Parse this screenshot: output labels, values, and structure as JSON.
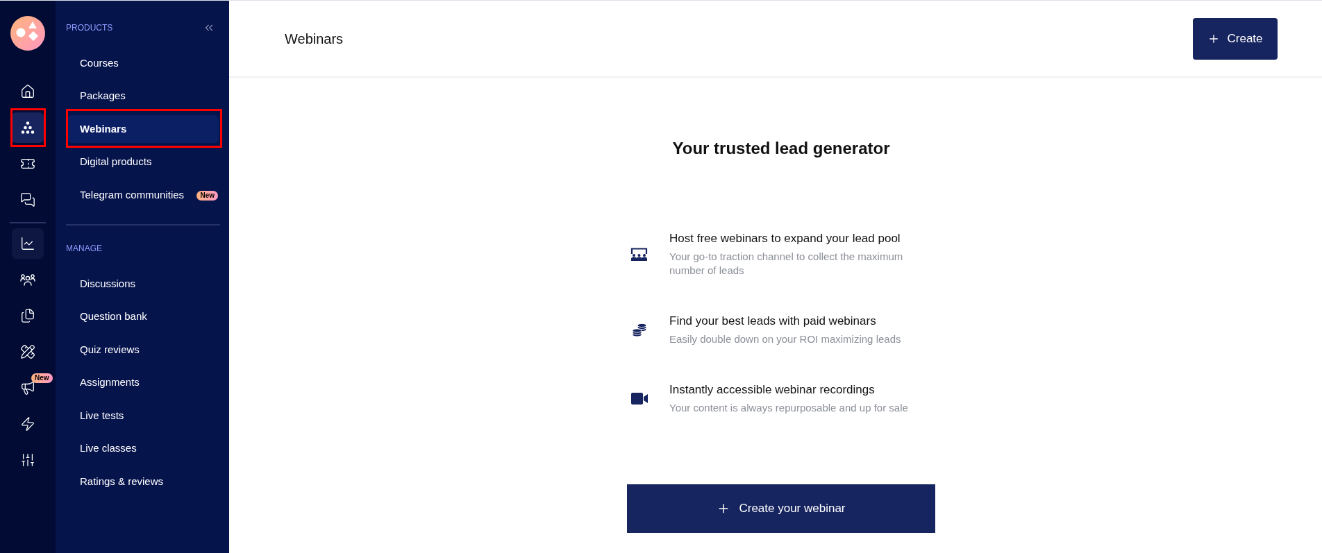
{
  "rail": {
    "sections": [
      {
        "items": [
          {
            "selected": false,
            "hovered": false,
            "outlined": false
          },
          {
            "selected": true,
            "hovered": false,
            "outlined": true
          },
          {
            "selected": false,
            "hovered": false,
            "outlined": false
          },
          {
            "selected": false,
            "hovered": false,
            "outlined": false
          }
        ]
      },
      {
        "items": [
          {
            "selected": false,
            "hovered": true,
            "outlined": false
          },
          {
            "selected": false,
            "hovered": false,
            "outlined": false
          },
          {
            "selected": false,
            "hovered": false,
            "outlined": false
          },
          {
            "selected": false,
            "hovered": false,
            "outlined": false
          },
          {
            "selected": false,
            "hovered": false,
            "outlined": false,
            "badge": "New"
          },
          {
            "selected": false,
            "hovered": false,
            "outlined": false
          },
          {
            "selected": false,
            "hovered": false,
            "outlined": false
          }
        ]
      }
    ]
  },
  "sidebar": {
    "sections": [
      {
        "heading": "PRODUCTS",
        "items": [
          {
            "label": "Courses",
            "selected": false,
            "outlined": false
          },
          {
            "label": "Packages",
            "selected": false,
            "outlined": false
          },
          {
            "label": "Webinars",
            "selected": true,
            "outlined": true
          },
          {
            "label": "Digital products",
            "selected": false,
            "outlined": false
          },
          {
            "label": "Telegram communities",
            "selected": false,
            "outlined": false,
            "badge": "New"
          }
        ]
      },
      {
        "heading": "MANAGE",
        "items": [
          {
            "label": "Discussions",
            "selected": false,
            "outlined": false
          },
          {
            "label": "Question bank",
            "selected": false,
            "outlined": false
          },
          {
            "label": "Quiz reviews",
            "selected": false,
            "outlined": false
          },
          {
            "label": "Assignments",
            "selected": false,
            "outlined": false
          },
          {
            "label": "Live tests",
            "selected": false,
            "outlined": false
          },
          {
            "label": "Live classes",
            "selected": false,
            "outlined": false
          },
          {
            "label": "Ratings & reviews",
            "selected": false,
            "outlined": false
          }
        ]
      }
    ]
  },
  "header": {
    "title": "Webinars",
    "create_button": "Create"
  },
  "intro": {
    "heading": "Your trusted lead generator",
    "features": [
      {
        "title": "Host free webinars to expand your lead pool",
        "description": "Your go-to traction channel to collect the maximum number of leads"
      },
      {
        "title": "Find your best leads with paid webinars",
        "description": "Easily double down on your ROI maximizing leads"
      },
      {
        "title": "Instantly accessible webinar recordings",
        "description": "Your content is always repurposable and up for sale"
      }
    ],
    "cta_button": "Create your webinar"
  }
}
